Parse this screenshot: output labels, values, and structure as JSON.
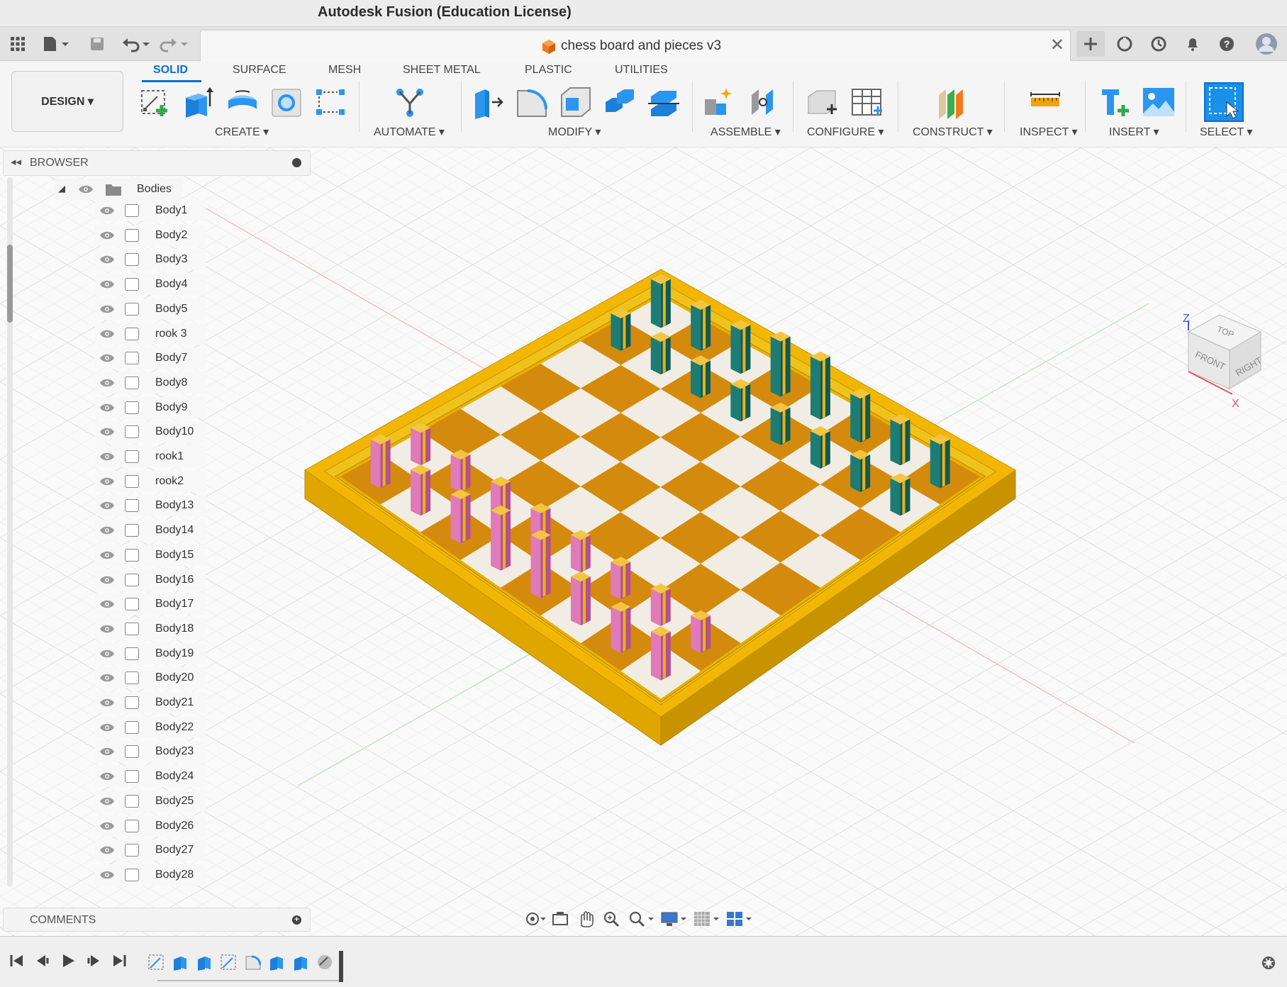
{
  "window": {
    "title": "Autodesk Fusion (Education License)"
  },
  "document": {
    "name": "chess board and pieces v3"
  },
  "ribbon": {
    "workspace": "DESIGN ▾",
    "tabs": [
      "SOLID",
      "SURFACE",
      "MESH",
      "SHEET METAL",
      "PLASTIC",
      "UTILITIES"
    ],
    "active_tab": "SOLID",
    "groups": [
      "CREATE ▾",
      "AUTOMATE ▾",
      "MODIFY ▾",
      "ASSEMBLE ▾",
      "CONFIGURE ▾",
      "CONSTRUCT ▾",
      "INSPECT ▾",
      "INSERT ▾",
      "SELECT ▾"
    ]
  },
  "browser": {
    "title": "BROWSER",
    "folder": "Bodies",
    "items": [
      "Body1",
      "Body2",
      "Body3",
      "Body4",
      "Body5",
      "rook 3",
      "Body7",
      "Body8",
      "Body9",
      "Body10",
      "rook1",
      "rook2",
      "Body13",
      "Body14",
      "Body15",
      "Body16",
      "Body17",
      "Body18",
      "Body19",
      "Body20",
      "Body21",
      "Body22",
      "Body23",
      "Body24",
      "Body25",
      "Body26",
      "Body27",
      "Body28"
    ]
  },
  "comments": {
    "title": "COMMENTS"
  },
  "viewcube": {
    "top": "TOP",
    "front": "FRONT",
    "right": "RIGHT",
    "z": "Z",
    "x": "X"
  },
  "colors": {
    "accent": "#0a6ed1",
    "board_frame": "#f2b705",
    "board_dark": "#d48a0d",
    "board_light": "#f1ede4",
    "pink_pieces": "#e07ab8",
    "teal_pieces": "#1d7d74"
  }
}
